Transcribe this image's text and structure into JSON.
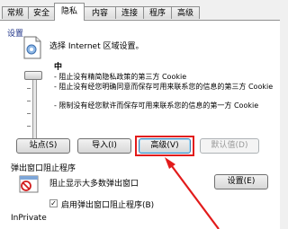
{
  "tabs": [
    "常规",
    "安全",
    "隐私",
    "内容",
    "连接",
    "程序",
    "高级"
  ],
  "settings": {
    "group_label": "设置",
    "zone_text": "选择 Internet 区域设置。",
    "level": "中",
    "descriptions": [
      "- 阻止没有精简隐私政策的第三方 Cookie",
      "- 阻止没有经您明确同意而保存可用来联系您的信息的第三方 Cookie",
      "- 限制没有经您默许而保存可用来联系您的信息的第一方 Cookie"
    ]
  },
  "buttons": {
    "sites": "站点(S)",
    "import": "导入(I)",
    "advanced": "高级(V)",
    "default": "默认值(D)"
  },
  "popup": {
    "label": "弹出窗口阻止程序",
    "no_location": "阻止显示大多数弹出窗口",
    "enable_blocker": "启用弹出窗口阻止程序(B)",
    "enable_checked": true,
    "settings_button": "设置(E)"
  },
  "inprivate": {
    "label": "InPrivate"
  },
  "colors": {
    "highlight": "#e21b1b",
    "section_label": "#1e3287"
  }
}
